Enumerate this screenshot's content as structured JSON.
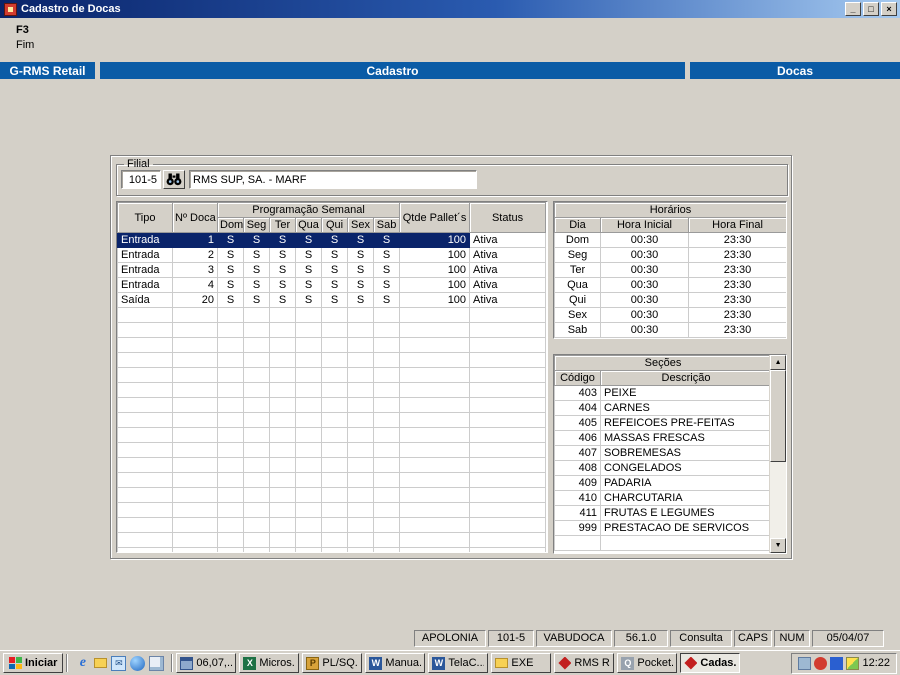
{
  "colors": {
    "title_gradient_left": "#0a246a",
    "title_gradient_right": "#a6caf0",
    "banner_blue": "#0a5ba6",
    "selection_navy": "#0a246a",
    "chrome_gray": "#d4d0c8"
  },
  "window": {
    "title": "Cadastro de Docas",
    "minimize": "_",
    "maximize": "□",
    "close": "×"
  },
  "menu": {
    "f3": "F3",
    "fim": "Fim"
  },
  "banner": {
    "left": "G-RMS Retail",
    "center": "Cadastro",
    "right": "Docas"
  },
  "filial": {
    "label": "Filial",
    "code": "101-5",
    "name": "RMS SUP, SA. - MARF"
  },
  "docas": {
    "col_tipo": "Tipo",
    "col_ndoca": "Nº Doca",
    "col_prog": "Programação Semanal",
    "days": [
      "Dom",
      "Seg",
      "Ter",
      "Qua",
      "Qui",
      "Sex",
      "Sab"
    ],
    "col_qtde": "Qtde Pallet´s",
    "col_status": "Status",
    "rows": [
      {
        "tipo": "Entrada",
        "ndoca": "1",
        "days": [
          "S",
          "S",
          "S",
          "S",
          "S",
          "S",
          "S"
        ],
        "qtde": "100",
        "status": "Ativa",
        "selected": true
      },
      {
        "tipo": "Entrada",
        "ndoca": "2",
        "days": [
          "S",
          "S",
          "S",
          "S",
          "S",
          "S",
          "S"
        ],
        "qtde": "100",
        "status": "Ativa"
      },
      {
        "tipo": "Entrada",
        "ndoca": "3",
        "days": [
          "S",
          "S",
          "S",
          "S",
          "S",
          "S",
          "S"
        ],
        "qtde": "100",
        "status": "Ativa"
      },
      {
        "tipo": "Entrada",
        "ndoca": "4",
        "days": [
          "S",
          "S",
          "S",
          "S",
          "S",
          "S",
          "S"
        ],
        "qtde": "100",
        "status": "Ativa"
      },
      {
        "tipo": "Saída",
        "ndoca": "20",
        "days": [
          "S",
          "S",
          "S",
          "S",
          "S",
          "S",
          "S"
        ],
        "qtde": "100",
        "status": "Ativa"
      }
    ]
  },
  "horarios": {
    "title": "Horários",
    "headers": [
      "Dia",
      "Hora Inicial",
      "Hora Final"
    ],
    "rows": [
      [
        "Dom",
        "00:30",
        "23:30"
      ],
      [
        "Seg",
        "00:30",
        "23:30"
      ],
      [
        "Ter",
        "00:30",
        "23:30"
      ],
      [
        "Qua",
        "00:30",
        "23:30"
      ],
      [
        "Qui",
        "00:30",
        "23:30"
      ],
      [
        "Sex",
        "00:30",
        "23:30"
      ],
      [
        "Sab",
        "00:30",
        "23:30"
      ]
    ]
  },
  "secoes": {
    "title": "Seções",
    "headers": [
      "Código",
      "Descrição"
    ],
    "scroll_up": "▲",
    "scroll_down": "▼",
    "rows": [
      [
        "403",
        "PEIXE"
      ],
      [
        "404",
        "CARNES"
      ],
      [
        "405",
        "REFEICOES PRE-FEITAS"
      ],
      [
        "406",
        "MASSAS FRESCAS"
      ],
      [
        "407",
        "SOBREMESAS"
      ],
      [
        "408",
        "CONGELADOS"
      ],
      [
        "409",
        "PADARIA"
      ],
      [
        "410",
        "CHARCUTARIA"
      ],
      [
        "411",
        "FRUTAS E LEGUMES"
      ],
      [
        "999",
        "PRESTACAO DE SERVICOS"
      ]
    ]
  },
  "statusbar": [
    "APOLONIA",
    "101-5",
    "VABUDOCA",
    "56.1.0",
    "Consulta",
    "CAPS",
    "NUM",
    "05/04/07"
  ],
  "taskbar": {
    "start": "Iniciar",
    "quick_launch": [
      "internet-explorer-icon",
      "folder-icon",
      "outlook-express-icon",
      "media-player-icon",
      "show-desktop-icon"
    ],
    "tasks": [
      {
        "label": "06,07,...",
        "icon": "window-icon"
      },
      {
        "label": "Micros...",
        "icon": "excel-icon"
      },
      {
        "label": "PL/SQ...",
        "icon": "plsql-icon"
      },
      {
        "label": "Manua...",
        "icon": "word-icon"
      },
      {
        "label": "TelaC...",
        "icon": "word-icon"
      },
      {
        "label": "EXE",
        "icon": "folder-icon"
      },
      {
        "label": "RMS R...",
        "icon": "rms-icon"
      },
      {
        "label": "Pocket...",
        "icon": "pocket-icon"
      },
      {
        "label": "Cadas...",
        "icon": "rms-icon",
        "active": true
      }
    ],
    "tray": [
      "tray-icon-1",
      "tray-icon-2",
      "tray-icon-3",
      "tray-icon-4"
    ],
    "clock": "12:22"
  }
}
